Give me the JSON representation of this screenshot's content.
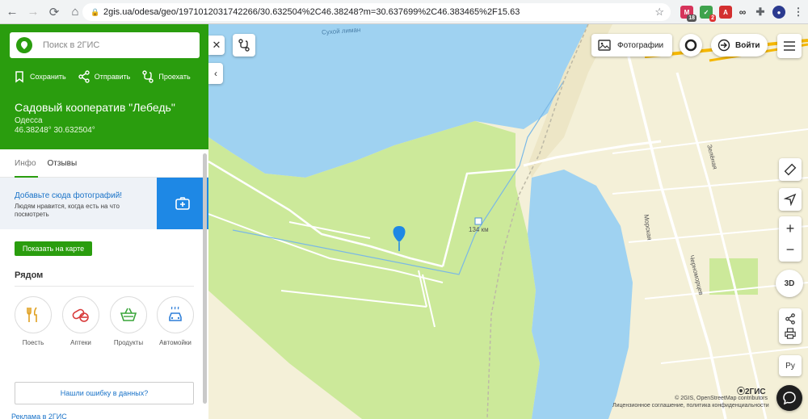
{
  "browser": {
    "url": "2gis.ua/odesa/geo/1971012031742266/30.632504%2C46.38248?m=30.637699%2C46.383465%2F15.63",
    "ext_badges": [
      "18",
      "2"
    ]
  },
  "search": {
    "placeholder": "Поиск в 2ГИС"
  },
  "actions": {
    "save": "Сохранить",
    "share": "Отправить",
    "route": "Проехать"
  },
  "place": {
    "title": "Садовый кооператив \"Лебедь\"",
    "city": "Одесса",
    "coords": "46.38248° 30.632504°"
  },
  "tabs": {
    "info": "Инфо",
    "reviews": "Отзывы"
  },
  "photo_prompt": {
    "title": "Добавьте сюда фотографий!",
    "text": "Людям нравится, когда есть на что посмотреть"
  },
  "show_on_map": "Показать на карте",
  "nearby": {
    "title": "Рядом",
    "categories": [
      {
        "label": "Поесть",
        "icon": "cutlery-icon",
        "color": "#e0a020"
      },
      {
        "label": "Аптеки",
        "icon": "pills-icon",
        "color": "#d83a3a"
      },
      {
        "label": "Продукты",
        "icon": "basket-icon",
        "color": "#3aa53a"
      },
      {
        "label": "Автомойки",
        "icon": "car-wash-icon",
        "color": "#2f7fd8"
      }
    ]
  },
  "error_button": "Нашли ошибку в данных?",
  "ad_link": "Реклама в 2ГИС",
  "map": {
    "photos_button": "Фотографии",
    "login_button": "Войти",
    "threed": "3D",
    "lang": "Ру",
    "distance_label": "134 км",
    "street_labels": [
      "Морская",
      "Черноморцев",
      "Зелёная"
    ],
    "lake_label": "Сухой лиман",
    "brand": "2ГИС",
    "copyright": "© 2GIS, OpenStreetMap contributors",
    "license": "Лицензионное соглашение, политика конфиденциальности",
    "colors": {
      "water": "#9fd2f1",
      "land": "#f4f0d8",
      "green": "#cce99a",
      "accent": "#2a9d0e",
      "road_major": "#f5b700",
      "pin": "#1e88e5"
    }
  }
}
